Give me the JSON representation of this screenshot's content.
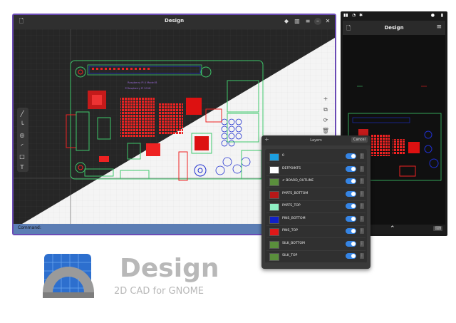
{
  "desktop": {
    "title": "Design",
    "command_label": "Command:",
    "board_text": [
      "Raspberry Pi 4 Model B",
      "©Raspberry Pi 2018"
    ]
  },
  "mobile": {
    "title": "Design"
  },
  "layers_dialog": {
    "title": "Layers",
    "cancel": "Cancel",
    "add_symbol": "+",
    "layers": [
      {
        "name": "0",
        "color": "#1c9fe0",
        "visible": true
      },
      {
        "name": "DEFPOINTS",
        "color": "#ffffff",
        "visible": true
      },
      {
        "name": "✔ BOARD_OUTLINE",
        "color": "#5a8f3c",
        "visible": true
      },
      {
        "name": "PARTS_BOTTOM",
        "color": "#b81818",
        "visible": true
      },
      {
        "name": "PARTS_TOP",
        "color": "#8ff0c4",
        "visible": true
      },
      {
        "name": "PINS_BOTTOM",
        "color": "#1020c8",
        "visible": true
      },
      {
        "name": "PINS_TOP",
        "color": "#e01818",
        "visible": true
      },
      {
        "name": "SILK_BOTTOM",
        "color": "#5a8f3c",
        "visible": true
      },
      {
        "name": "SILK_TOP",
        "color": "#5a8f3c",
        "visible": true
      }
    ]
  },
  "branding": {
    "app_name": "Design",
    "tagline": "2D CAD for GNOME"
  },
  "colors": {
    "accent": "#3584e4",
    "window_border": "#6b4bb5",
    "command_bar": "#5b7db4"
  }
}
